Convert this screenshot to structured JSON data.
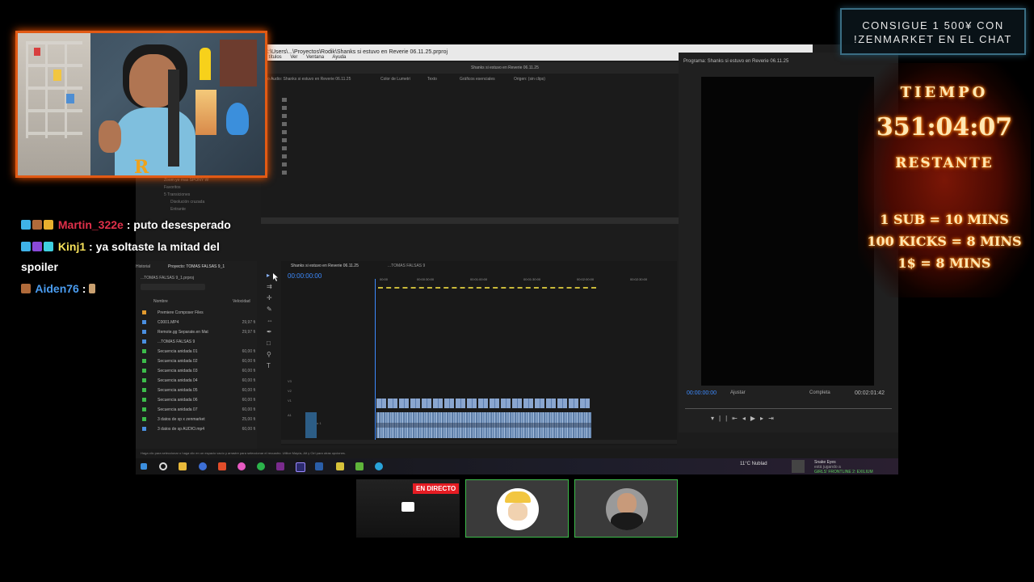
{
  "premiere": {
    "title": "C:\\Users\\...\\Proyectos\\Rodik\\Shanks si estuvo en Reverie 06.11.25.prproj",
    "menu": [
      "...y títulos",
      "Ver",
      "Ventana",
      "Ayuda"
    ],
    "source_header": "Shanks si estuvo en Reverie 06.11.25",
    "source_tabs": [
      "...dio Audio: Shanks si estuvo en Reverie 06.11.25",
      "Color de Lumetri",
      "Texto",
      "Gráficos esenciales",
      "Origen: (sin clips)"
    ],
    "program_title": "Programa: Shanks si estuvo en Reverie 06.11.25",
    "program_tc": "00:00:00:00",
    "program_fit": "Ajustar",
    "program_quality": "Completa",
    "program_duration": "00:02:01:42",
    "project_tabs": [
      "Historial",
      "Proyecto: TOMAS FALSAS 9_1"
    ],
    "project_file": "...TOMAS FALSAS 9_1.prproj",
    "project_cols": [
      "Nombre",
      "Velocidad"
    ],
    "project_items": [
      {
        "name": "Premiere Composer Files",
        "fps": "",
        "color": "#e29a2e"
      },
      {
        "name": "C0001.MP4",
        "fps": "29,97 fi",
        "color": "#4a8fe0"
      },
      {
        "name": "Remote.gg Separate.en Mat",
        "fps": "29,97 fi",
        "color": "#4a8fe0"
      },
      {
        "name": "...TOMAS FALSAS 9",
        "fps": "",
        "color": "#4a8fe0"
      },
      {
        "name": "Secuencia anidada 01",
        "fps": "60,00 fi",
        "color": "#3cbc4a"
      },
      {
        "name": "Secuencia anidada 02",
        "fps": "60,00 fi",
        "color": "#3cbc4a"
      },
      {
        "name": "Secuencia anidada 03",
        "fps": "60,00 fi",
        "color": "#3cbc4a"
      },
      {
        "name": "Secuencia anidada 04",
        "fps": "60,00 fi",
        "color": "#3cbc4a"
      },
      {
        "name": "Secuencia anidada 05",
        "fps": "60,00 fi",
        "color": "#3cbc4a"
      },
      {
        "name": "Secuencia anidada 06",
        "fps": "60,00 fi",
        "color": "#3cbc4a"
      },
      {
        "name": "Secuencia anidada 07",
        "fps": "60,00 fi",
        "color": "#3cbc4a"
      },
      {
        "name": "3 datos de sp x zenmarket",
        "fps": "25,00 fi",
        "color": "#3cbc4a"
      },
      {
        "name": "3 datos de sp AUDIO.mp4",
        "fps": "60,00 fi",
        "color": "#4a8fe0"
      }
    ],
    "effects_items": [
      "Zoom ye mas SPONY W",
      "Favoritos",
      "5 Transiciones",
      "Disolución cruzada",
      "Entrante"
    ],
    "timeline_tab": "Shanks si estuvo en Reverie 06.11.25",
    "timeline_tab2": "...TOMAS FALSAS 9",
    "timeline_tc": "00:00:00:00",
    "ruler": [
      "00:00",
      "00:00:30:00",
      "00:01:00:00",
      "00:01:30:00",
      "00:02:00:00",
      "00:02:30:00"
    ],
    "tracks": [
      "V3",
      "V2",
      "V1",
      "A1",
      "Audio 1",
      "A2",
      "Audio 2",
      "A3"
    ],
    "status": "Haga clic para seleccionar o haga clic en un espacio vacío y arrastre para seleccionar el recuadro. Utilice Mayús, Alt y Ctrl para otras opciones.",
    "weather": "11°C  Nublad",
    "game_title": "Snake Eyes",
    "game_status": "está jugando a",
    "game_name": "GIRLS' FRONTLINE 2: EXILIUM"
  },
  "chat": [
    {
      "user": "Martin_322e",
      "msg": ": puto desesperado",
      "color": "#e0304a"
    },
    {
      "user": "Kinj1",
      "msg": ": ya soltaste la mitad del",
      "msg2": "spoiler",
      "color": "#f5e05a"
    },
    {
      "user": "Aiden76",
      "msg": ":",
      "color": "#4a9cf0"
    }
  ],
  "banner": {
    "line1": "CONSIGUE 1 500¥ CON",
    "line2": "!ZENMARKET EN EL CHAT"
  },
  "timer": {
    "label": "TIEMPO",
    "value": "351:04:07",
    "remaining": "RESTANTE",
    "rule1": "1 SUB = 10 MINS",
    "rule2": "100 KICKS = 8 MINS",
    "rule3": "1$ = 8 MINS"
  },
  "live_badge": "EN DIRECTO"
}
